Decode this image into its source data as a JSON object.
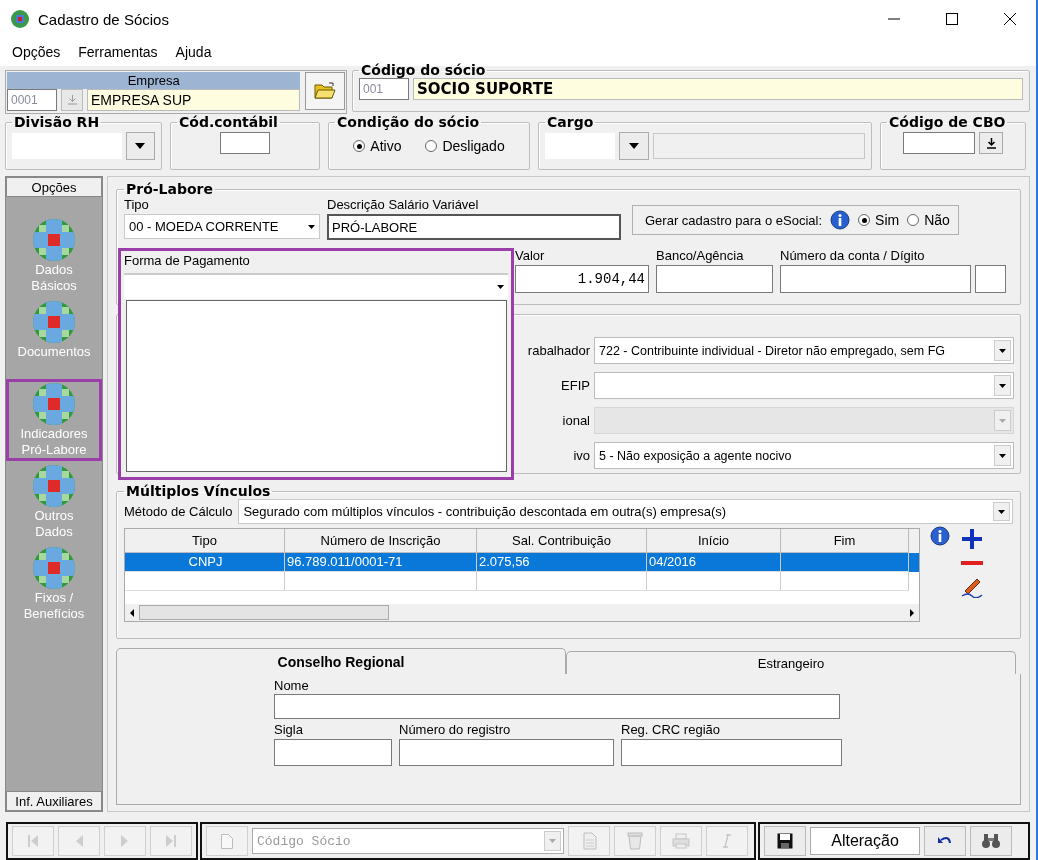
{
  "window": {
    "title": "Cadastro de Sócios"
  },
  "menu": [
    "Opções",
    "Ferramentas",
    "Ajuda"
  ],
  "empresa": {
    "label": "Empresa",
    "code": "0001",
    "name": "EMPRESA SUP"
  },
  "socio": {
    "label": "Código do sócio",
    "code": "001",
    "name": "SOCIO SUPORTE"
  },
  "divisao_rh": {
    "label": "Divisão RH"
  },
  "cod_contabil": {
    "label": "Cód.contábil"
  },
  "condicao": {
    "label": "Condição do sócio",
    "options": [
      {
        "label": "Ativo",
        "selected": true
      },
      {
        "label": "Desligado",
        "selected": false
      }
    ]
  },
  "cargo": {
    "label": "Cargo"
  },
  "cbo": {
    "label": "Código de CBO"
  },
  "sidebar": {
    "header": "Opções",
    "footer": "Inf. Auxiliares",
    "items": [
      {
        "lines": [
          "Dados",
          "Básicos"
        ],
        "selected": false
      },
      {
        "lines": [
          "Documentos"
        ],
        "selected": false
      },
      {
        "lines": [
          "Indicadores",
          "Pró-Labore"
        ],
        "selected": true
      },
      {
        "lines": [
          "Outros",
          "Dados"
        ],
        "selected": false
      },
      {
        "lines": [
          "Fixos /",
          "Benefícios"
        ],
        "selected": false
      }
    ]
  },
  "pro_labore": {
    "title": "Pró-Labore",
    "tipo": {
      "label": "Tipo",
      "value": "00 - MOEDA CORRENTE"
    },
    "descricao": {
      "label": "Descrição Salário Variável",
      "value": "PRÓ-LABORE"
    },
    "esocial": {
      "label": "Gerar cadastro para o eSocial:",
      "options": [
        {
          "label": "Sim",
          "selected": true
        },
        {
          "label": "Não",
          "selected": false
        }
      ]
    },
    "forma_pagamento": {
      "label": "Forma de Pagamento",
      "expanded": true
    },
    "valor": {
      "label": "Valor",
      "value": "1.904,44"
    },
    "banco": {
      "label": "Banco/Agência"
    },
    "conta": {
      "label": "Número da conta / Dígito"
    }
  },
  "indicadores": [
    {
      "label": "rabalhador",
      "value": "722 - Contribuinte individual - Diretor não empregado, sem FG",
      "disabled": false
    },
    {
      "label": "EFIP",
      "disabled": false
    },
    {
      "label": "ional",
      "disabled": true
    },
    {
      "label": "ivo",
      "value": "5 - Não exposição a agente nocivo",
      "disabled": false
    }
  ],
  "multiplos": {
    "title": "Múltiplos Vínculos",
    "metodo_label": "Método de Cálculo",
    "metodo_value": "Segurado com múltiplos vínculos - contribuição descontada em outra(s) empresa(s)",
    "columns": [
      "Tipo",
      "Número de Inscrição",
      "Sal. Contribuição",
      "Início",
      "Fim"
    ],
    "rows": [
      {
        "cells": [
          "CNPJ",
          "96.789.011/0001-71",
          "2.075,56",
          "04/2016"
        ],
        "selected": true
      }
    ]
  },
  "tabs": [
    {
      "label": "Conselho Regional",
      "selected": true
    },
    {
      "label": "Estrangeiro",
      "selected": false
    }
  ],
  "conselho": {
    "nome": "Nome",
    "sigla": "Sigla",
    "numero": "Número do registro",
    "crc": "Reg. CRC região"
  },
  "toolbar": {
    "nav": [
      {
        "kind": "first",
        "disabled": true
      },
      {
        "kind": "prev",
        "disabled": true
      },
      {
        "kind": "next",
        "disabled": true
      },
      {
        "kind": "last",
        "disabled": true
      }
    ],
    "actions": [
      {
        "kind": "copy",
        "disabled": true
      },
      {
        "kind": "delete",
        "disabled": true
      },
      {
        "kind": "print",
        "disabled": true
      },
      {
        "kind": "italic",
        "disabled": true
      }
    ],
    "placeholder": "Código Sócio",
    "status": "Alteração"
  }
}
